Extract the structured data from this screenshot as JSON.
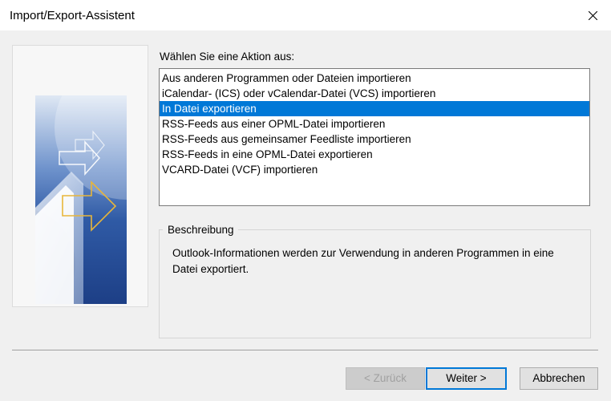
{
  "window": {
    "title": "Import/Export-Assistent"
  },
  "prompt": "Wählen Sie eine Aktion aus:",
  "actions": [
    "Aus anderen Programmen oder Dateien importieren",
    "iCalendar- (ICS) oder vCalendar-Datei (VCS) importieren",
    "In Datei exportieren",
    "RSS-Feeds aus einer OPML-Datei importieren",
    "RSS-Feeds aus gemeinsamer Feedliste importieren",
    "RSS-Feeds in eine OPML-Datei exportieren",
    "VCARD-Datei (VCF) importieren"
  ],
  "selected_action": "In Datei exportieren",
  "description": {
    "legend": "Beschreibung",
    "text": "Outlook-Informationen werden zur Verwendung in anderen Programmen in eine Datei exportiert."
  },
  "buttons": {
    "back": "< Zurück",
    "next": "Weiter >",
    "cancel": "Abbrechen"
  },
  "colors": {
    "selection": "#0078d7",
    "art_blue": "#2f5aa5"
  }
}
